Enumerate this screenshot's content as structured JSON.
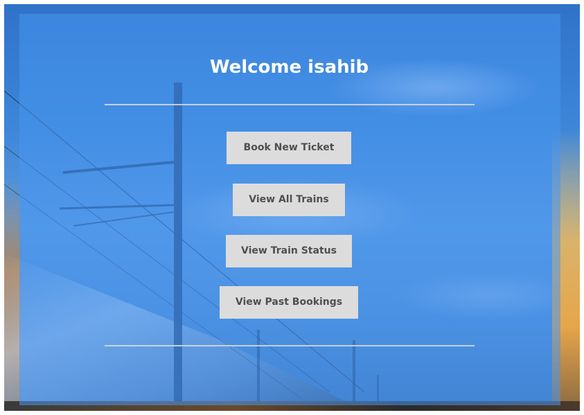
{
  "header": {
    "welcome_text": "Welcome isahib"
  },
  "menu": {
    "buttons": [
      {
        "label": "Book New Ticket"
      },
      {
        "label": "View All Trains"
      },
      {
        "label": "View Train Status"
      },
      {
        "label": "View Past Bookings"
      }
    ]
  },
  "theme": {
    "panel_color": "#4896f0",
    "button_bg": "#dcdcdc",
    "button_text": "#4f4f4f",
    "title_color": "#ffffff"
  }
}
